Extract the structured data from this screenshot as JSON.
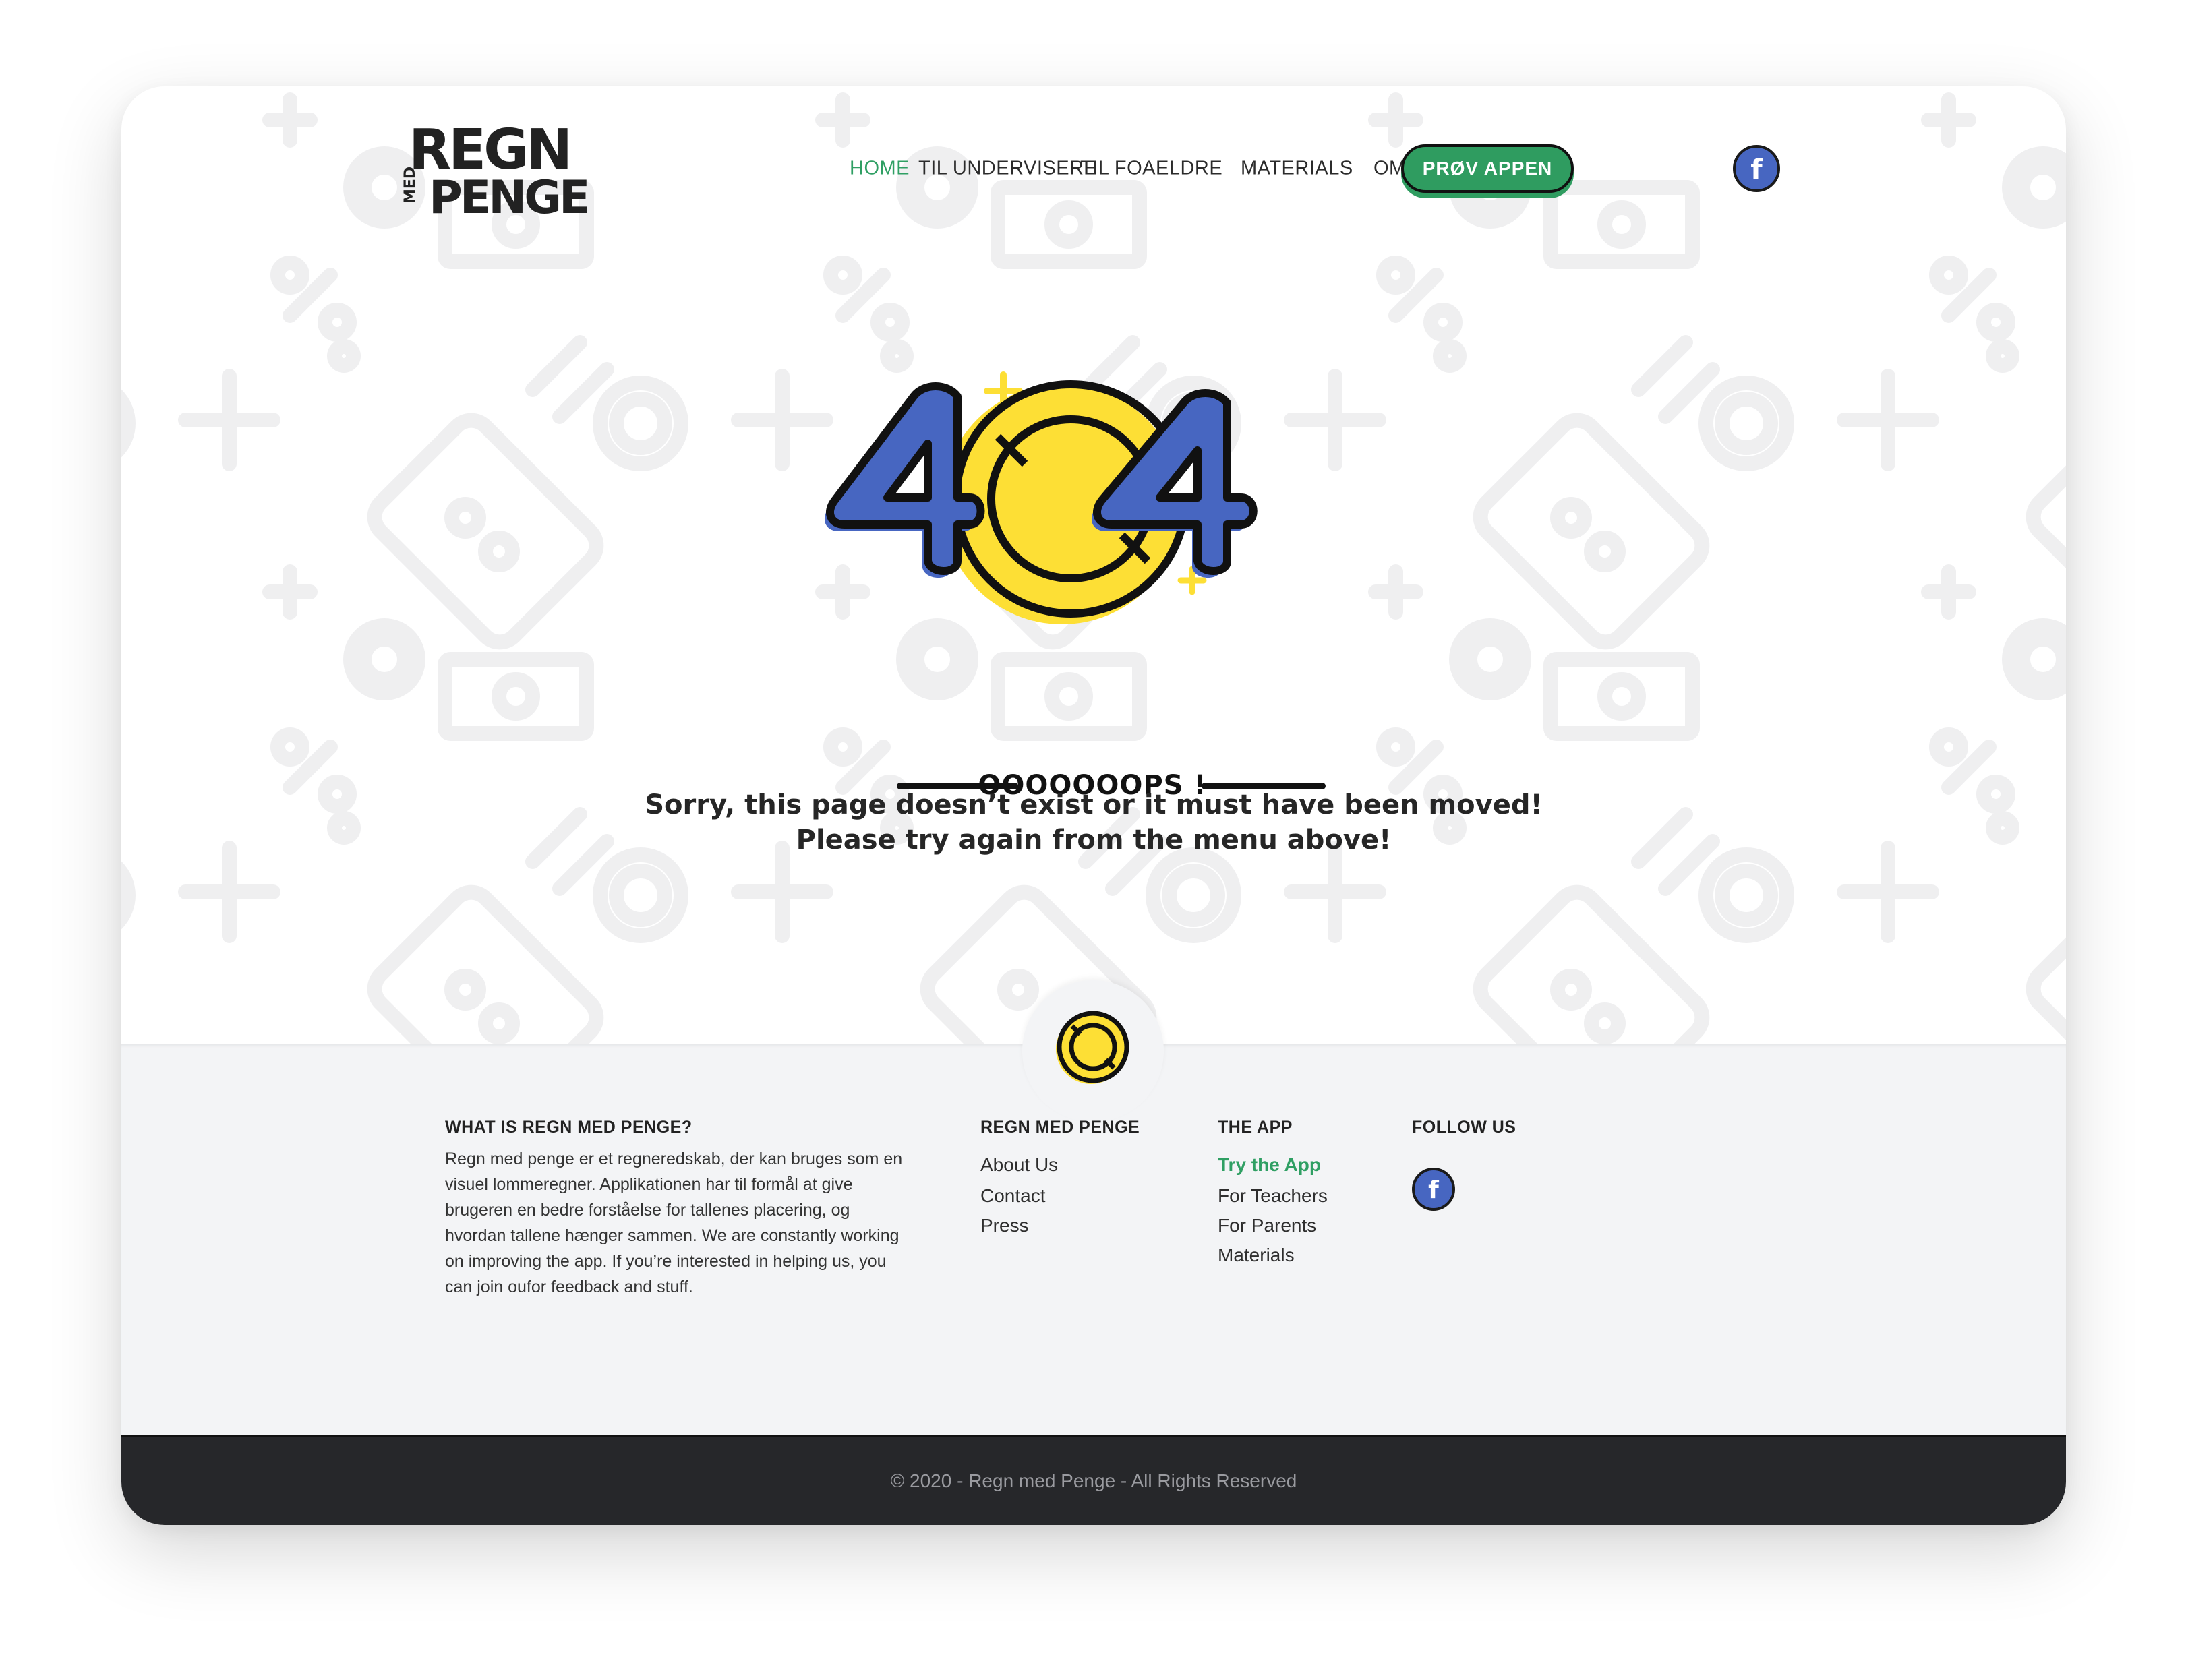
{
  "brand": {
    "logo_top": "REGN",
    "logo_small": "MED",
    "logo_bottom": "PENGE"
  },
  "nav": {
    "items": [
      {
        "label": "HOME",
        "active": true
      },
      {
        "label": "TIL UNDERVISERE",
        "active": false
      },
      {
        "label": "TIL FOAELDRE",
        "active": false
      },
      {
        "label": "MATERIALS",
        "active": false
      },
      {
        "label": "OM OS",
        "active": false
      }
    ],
    "cta_label": "PRØV APPEN",
    "social_icon": "facebook-icon"
  },
  "error": {
    "code_digit_1": "4",
    "code_digit_2": "4",
    "oops": "OOOOOOOPS !",
    "message_line1": "Sorry, this page doesn’t exist or it must have been moved!",
    "message_line2": "Please try again from the menu above!"
  },
  "footer": {
    "about_heading": "WHAT IS REGN MED PENGE?",
    "about_text": "Regn med penge er et regneredskab, der kan bruges som en visuel lommeregner. Applikationen har til formål at give brugeren en bedre forståelse for tallenes placering, og hvordan tallene hænger sammen. We are constantly working on improving the app. If you’re interested in helping us, you can join oufor feedback and stuff.",
    "col_regn": {
      "heading": "REGN MED PENGE",
      "links": [
        "About Us",
        "Contact",
        "Press"
      ]
    },
    "col_app": {
      "heading": "THE APP",
      "links": [
        "Try the App",
        "For Teachers",
        "For Parents",
        "Materials"
      ]
    },
    "col_follow": {
      "heading": "FOLLOW US",
      "icon": "facebook-icon"
    },
    "copyright": "© 2020 - Regn med Penge  - All Rights Reserved"
  },
  "colors": {
    "accent_green": "#2f9f63",
    "brand_blue": "#4766c1",
    "coin_yellow": "#fddf35",
    "footer_bg": "#f3f4f6",
    "bottom_bar": "#26272a"
  }
}
